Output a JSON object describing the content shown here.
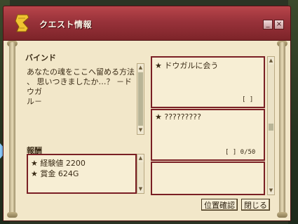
{
  "window": {
    "title": "クエスト情報"
  },
  "titlebar": {
    "minimize_glyph": "_",
    "close_glyph": "×"
  },
  "quest": {
    "name": "バインド",
    "description": "あなたの魂をここへ留める方法\n、 思いつきましたか…？ －ドウガ\nル－"
  },
  "objectives": [
    {
      "text": "★ ドウガルに会う",
      "progress": "[ ]"
    },
    {
      "text": "★ ?????????",
      "progress": "[ ] 0/50"
    }
  ],
  "rewards": {
    "label": "報酬",
    "items": [
      "★ 経験値 2200",
      "★ 賞金 624G"
    ]
  },
  "buttons": {
    "locate": "位置確認",
    "close": "閉じる"
  }
}
